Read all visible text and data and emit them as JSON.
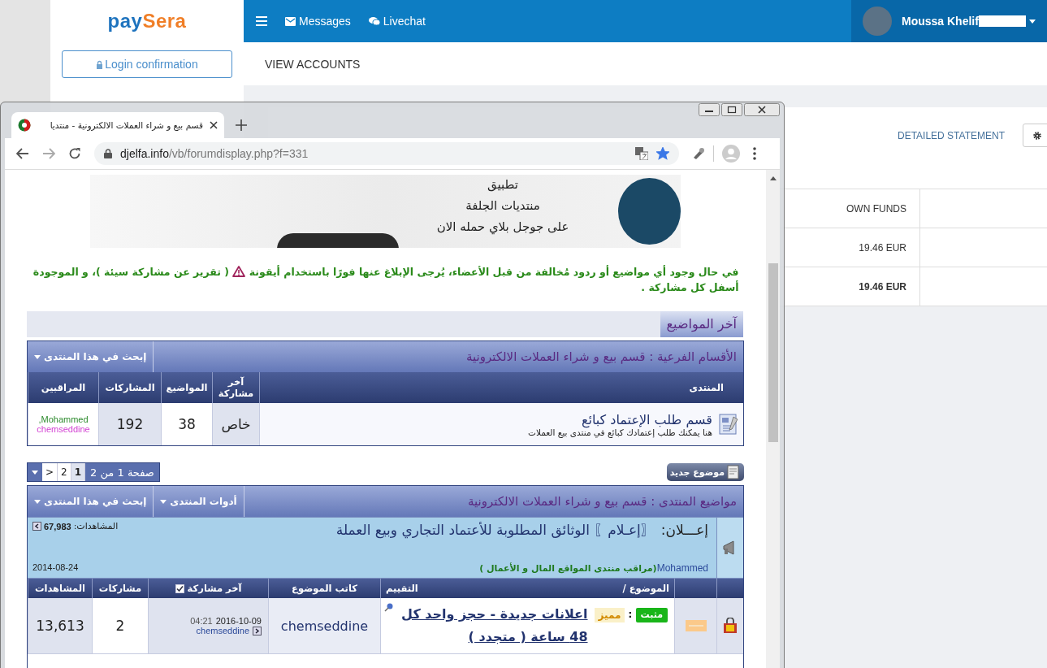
{
  "paysera": {
    "logo": "paySera",
    "messages_link": "Messages",
    "livechat_link": "Livechat",
    "user": {
      "name": "Moussa Khelif"
    },
    "login_button": "Login confirmation",
    "page_title": "VIEW ACCOUNTS",
    "account": {
      "statement_link": "DETAILED STATEMENT",
      "column": "OWN FUNDS",
      "rows": [
        {
          "value": "19.46 EUR",
          "total": false
        },
        {
          "value": "19.46 EUR",
          "total": true
        }
      ]
    }
  },
  "browser": {
    "tab_title": "قسم بيع و شراء العملات الالكترونية - منتديا",
    "url_host": "djelfa.info",
    "url_path": "/vb/forumdisplay.php?f=331",
    "bookmarked": true
  },
  "banner": {
    "lines": [
      "تطبيق",
      "منتديات الجلفة",
      "على جوجل بلاي حمله الان"
    ]
  },
  "notice": {
    "before": "في حال وجود أي مواضيع أو ردود مُخالفة من قبل الأعضاء، يُرجى الإبلاغ عنها فورًا باستخدام أيقونة",
    "after": "( تقرير عن مشاركة سيئة )، و الموجودة أسفل كل مشاركة ."
  },
  "latest_tab": "آخر المواضيع",
  "subforums": {
    "title": "الأقسام الفرعية : قسم بيع و شراء العملات الالكترونية",
    "search": "إبحث في هذا المنتدى",
    "columns": [
      "المنتدى",
      "آخر مشاركة",
      "المواضيع",
      "المشاركات",
      "المراقبين"
    ],
    "rows": [
      {
        "title": "قسم طلب الإعتماد كبائع",
        "description": "هنا يمكنك طلب إعتمادك كبائع في منتدى بيع العملات",
        "last_post": "خاص",
        "topics": "38",
        "posts": "192",
        "moderators": [
          {
            "name": "Mohammed,",
            "color": "#2e8b2e"
          },
          {
            "name": "chemseddine",
            "color": "#d23fd2"
          }
        ]
      }
    ]
  },
  "new_topic": "موضوع جديد",
  "pagination": {
    "label": "صفحة 1 من 2",
    "pages": [
      {
        "label": "1",
        "selected": true
      },
      {
        "label": "2",
        "selected": false
      }
    ],
    "next": ">"
  },
  "threads": {
    "title": "مواضيع المنتدى : قسم بيع و شراء العملات الالكترونية",
    "tools": "أدوات المنتدى",
    "search": "إبحث في هذا المنتدى",
    "announcement": {
      "prefix": "إعـــلان:",
      "title": "〖إعـلام〗 الوثائق المطلوبة للأعتماد التجاري وبيع العملة",
      "views_label": "المشاهدات:",
      "views": "67,983",
      "date": "2014-08-24",
      "author": "Mohammed",
      "role": "(مراقب منتدى المواقع المال و الأعمال )"
    },
    "columns": {
      "topic": "الموضوع /",
      "rating": "التقييم",
      "author": "كاتب الموضوع",
      "last_post": "آخر مشاركة",
      "replies": "مشاركات",
      "views": "المشاهدات"
    },
    "rows": [
      {
        "sticky": "مثبت",
        "separator": ":",
        "featured": "مميز",
        "title": "اعلانات جديدة - حجز واحد كل 48 ساعة ( متجدد )",
        "author": "chemseddine",
        "date": "2016-10-09",
        "time": "04:21",
        "last_by": "chemseddine",
        "replies": "2",
        "views": "13,613"
      }
    ]
  }
}
